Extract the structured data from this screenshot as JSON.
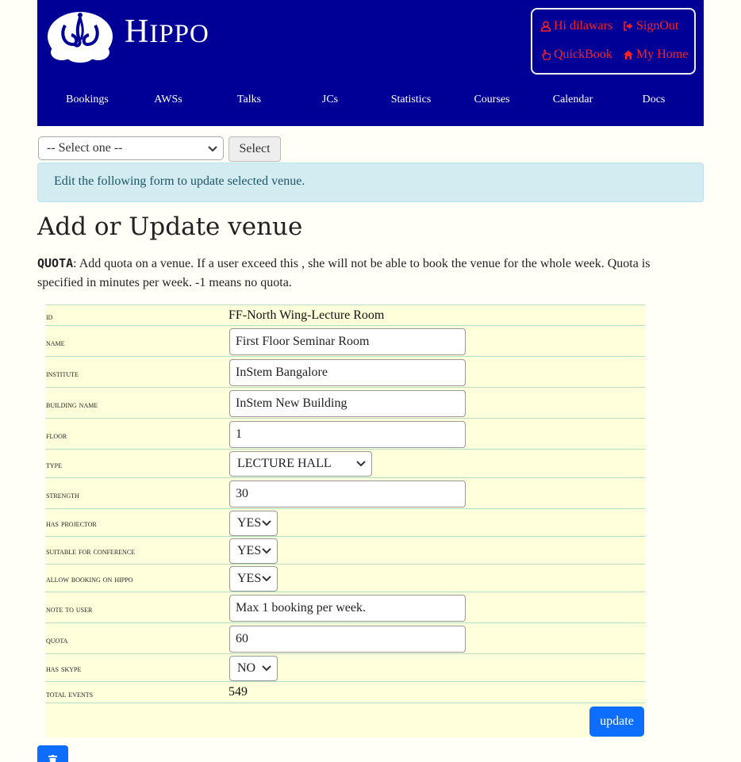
{
  "header": {
    "brand_initial": "H",
    "brand_rest": "IPPO",
    "user_links": [
      {
        "label": "Hi dilawars",
        "icon": "user-icon"
      },
      {
        "label": "SignOut",
        "icon": "sign-out-icon"
      },
      {
        "label": "QuickBook",
        "icon": "hand-pointer-icon"
      },
      {
        "label": "My Home",
        "icon": "home-icon"
      }
    ],
    "nav": [
      "Bookings",
      "AWSs",
      "Talks",
      "JCs",
      "Statistics",
      "Courses",
      "Calendar",
      "Docs"
    ]
  },
  "venue_select": {
    "value": "-- Select one --",
    "button": "Select"
  },
  "info_message": "Edit the following form to update selected venue.",
  "page_title": "Add or Update venue",
  "description": {
    "keyword": "QUOTA",
    "text": ": Add quota on a venue. If a user exceed this , she will not be able to book the venue for the whole week. Quota is specified in minutes per week. -1 means no quota."
  },
  "form": {
    "id_label": "id",
    "id_value": "FF-North Wing-Lecture Room",
    "name_label": "name",
    "name_value": "First Floor Seminar Room",
    "institute_label": "institute",
    "institute_value": "InStem Bangalore",
    "building_label": "building name",
    "building_value": "InStem New Building",
    "floor_label": "floor",
    "floor_value": "1",
    "type_label": "type",
    "type_value": "LECTURE HALL",
    "strength_label": "strength",
    "strength_value": "30",
    "projector_label": "has projector",
    "projector_value": "YES",
    "conference_label": "suitable for conference",
    "conference_value": "YES",
    "booking_label": "allow booking on hippo",
    "booking_value": "YES",
    "note_label": "note to user",
    "note_value": "Max 1 booking per week.",
    "quota_label": "quota",
    "quota_value": "60",
    "skype_label": "has skype",
    "skype_value": "NO",
    "events_label": "total events",
    "events_value": "549",
    "update_button": "update"
  },
  "colors": {
    "header_bg": "#000096",
    "user_link": "#ff2020",
    "form_bg": "#ffffdc",
    "info_bg": "#d2ecf1",
    "primary_button": "#0d6efd"
  }
}
